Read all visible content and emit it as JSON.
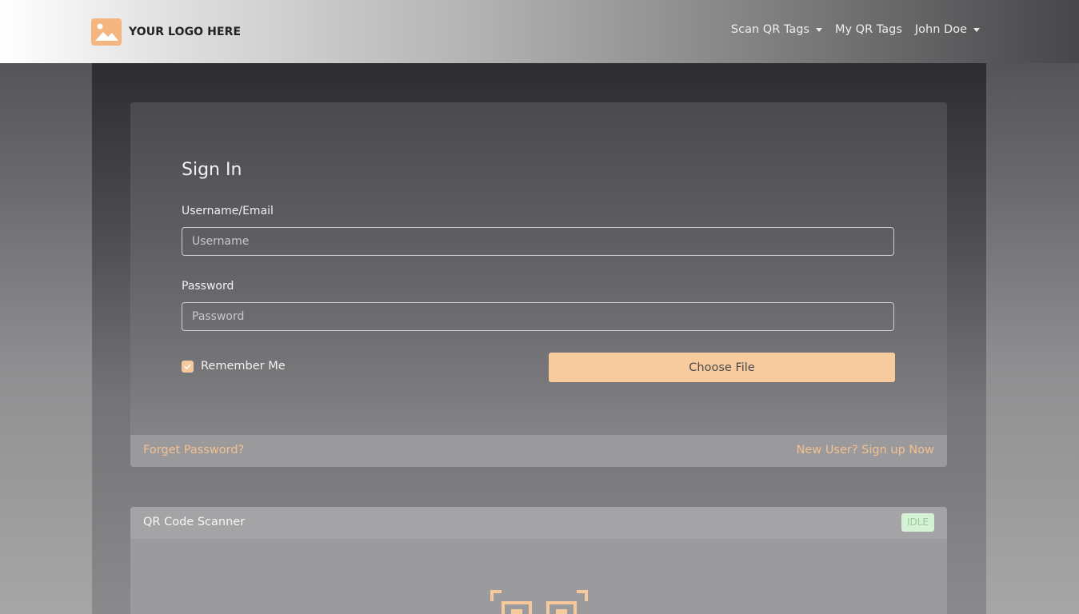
{
  "brand": {
    "text": "YOUR LOGO HERE",
    "logo_icon": "image-placeholder-icon",
    "logo_color": "#f4b57e"
  },
  "nav": {
    "scan_qr_tags": "Scan QR Tags",
    "my_qr_tags": "My QR Tags",
    "user": "John Doe"
  },
  "signin": {
    "title": "Sign In",
    "username_label": "Username/Email",
    "username_placeholder": "Username",
    "username_value": "",
    "password_label": "Password",
    "password_placeholder": "Password",
    "password_value": "",
    "remember_label": "Remember Me",
    "remember_checked": true,
    "choose_file_label": "Choose File",
    "forget_password": "Forget Password?",
    "signup": "New User? Sign up Now"
  },
  "scanner": {
    "title": "QR Code Scanner",
    "status": "IDLE",
    "icon": "qr-scan-icon"
  },
  "colors": {
    "accent": "#f7cb9e",
    "link": "#f4c08f",
    "status_bg": "#d6f2d6",
    "status_text": "#9ccc9c"
  }
}
